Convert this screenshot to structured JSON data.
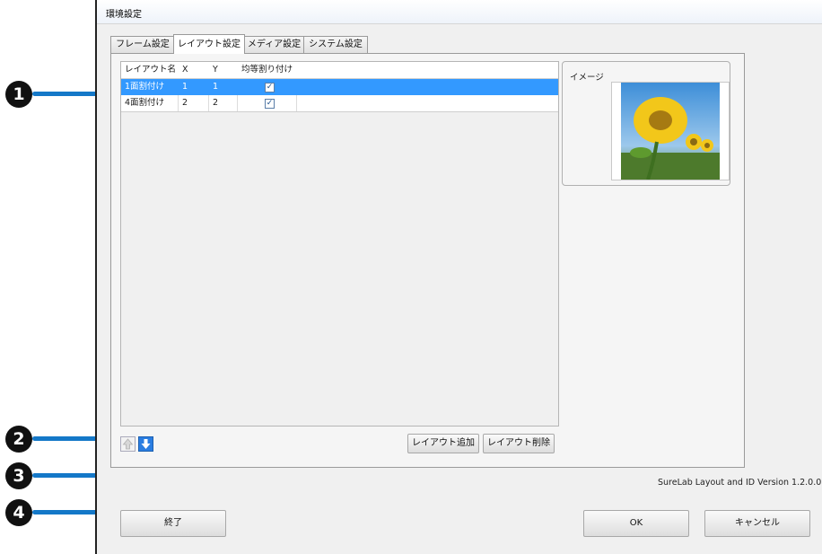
{
  "window": {
    "title": "環境設定",
    "close_icon": "close-icon"
  },
  "tabs": [
    {
      "label": "フレーム設定",
      "active": false
    },
    {
      "label": "レイアウト設定",
      "active": true
    },
    {
      "label": "メディア設定",
      "active": false
    },
    {
      "label": "システム設定",
      "active": false
    }
  ],
  "layout_table": {
    "columns": [
      "レイアウト名",
      "X",
      "Y",
      "均等割り付け"
    ],
    "rows": [
      {
        "name": "1面割付け",
        "x": "1",
        "y": "1",
        "even": true,
        "selected": true
      },
      {
        "name": "4面割付け",
        "x": "2",
        "y": "2",
        "even": true,
        "selected": false
      }
    ],
    "check_glyph": "✓"
  },
  "buttons": {
    "move_up_icon": "arrow-up-icon",
    "move_down_icon": "arrow-down-icon",
    "add_layout": "レイアウト追加",
    "delete_layout": "レイアウト削除",
    "exit": "終了",
    "ok": "OK",
    "cancel": "キャンセル"
  },
  "preview": {
    "label": "イメージ",
    "image": "sunflower-photo"
  },
  "version_text": "SureLab Layout and ID Version 1.2.0.0",
  "callouts": [
    "1",
    "2",
    "3",
    "4"
  ],
  "colors": {
    "selection": "#3399ff",
    "callout_line": "#1478c8",
    "callout_badge": "#111111"
  }
}
